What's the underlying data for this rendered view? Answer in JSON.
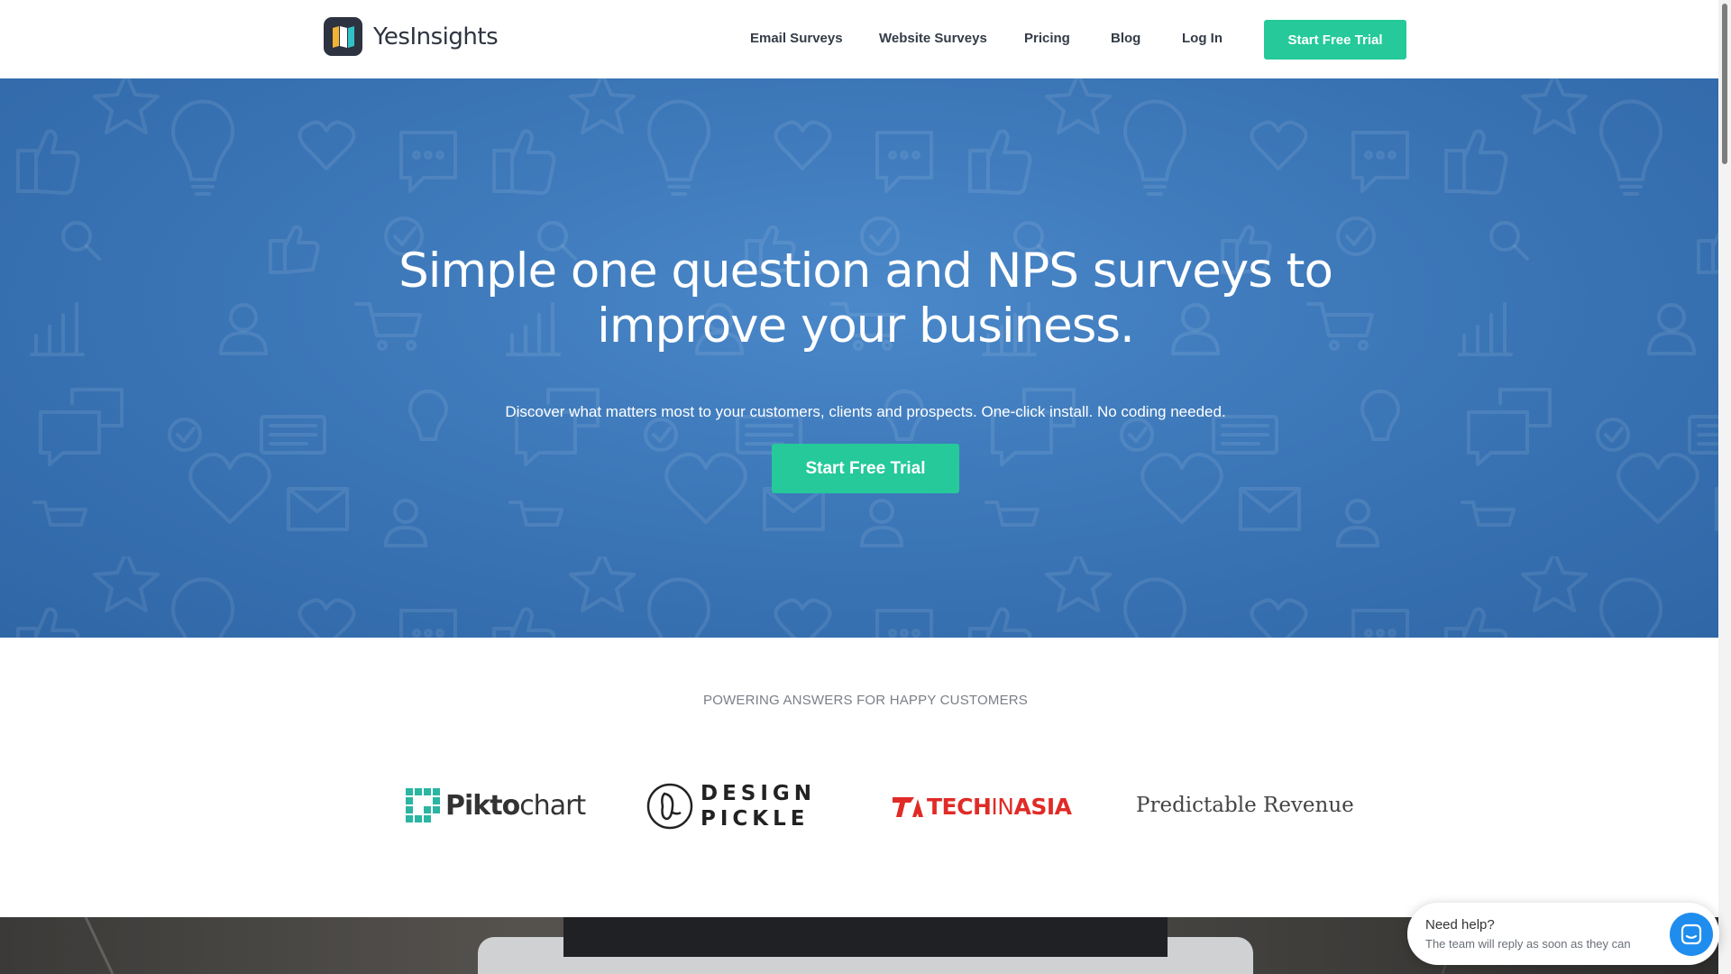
{
  "header": {
    "brand": "YesInsights",
    "nav": [
      {
        "label": "Email Surveys"
      },
      {
        "label": "Website Surveys"
      },
      {
        "label": "Pricing"
      },
      {
        "label": "Blog"
      },
      {
        "label": "Log In"
      }
    ],
    "cta_label": "Start Free Trial"
  },
  "hero": {
    "title_line1": "Simple one question and NPS surveys to",
    "title_line2": "improve your business.",
    "subtitle": "Discover what matters most to your customers, clients and prospects. One-click install. No coding needed.",
    "cta_label": "Start Free Trial"
  },
  "customers": {
    "heading": "POWERING ANSWERS FOR HAPPY CUSTOMERS",
    "logos": {
      "piktochart": {
        "bold": "Pikto",
        "rest": "chart"
      },
      "design_pickle": {
        "line1": "DESIGN",
        "line2": "PICKLE"
      },
      "techinasia": {
        "word1": "TECH",
        "word2": "IN",
        "word3": "ASIA"
      },
      "predictable_revenue": "Predictable Revenue"
    }
  },
  "chat": {
    "title": "Need help?",
    "subtitle": "The team will reply as soon as they can"
  },
  "colors": {
    "accent": "#25c99a",
    "hero_blue": "#3c77b8",
    "chat_blue": "#1f8ded",
    "techinasia_red": "#e02b27"
  }
}
